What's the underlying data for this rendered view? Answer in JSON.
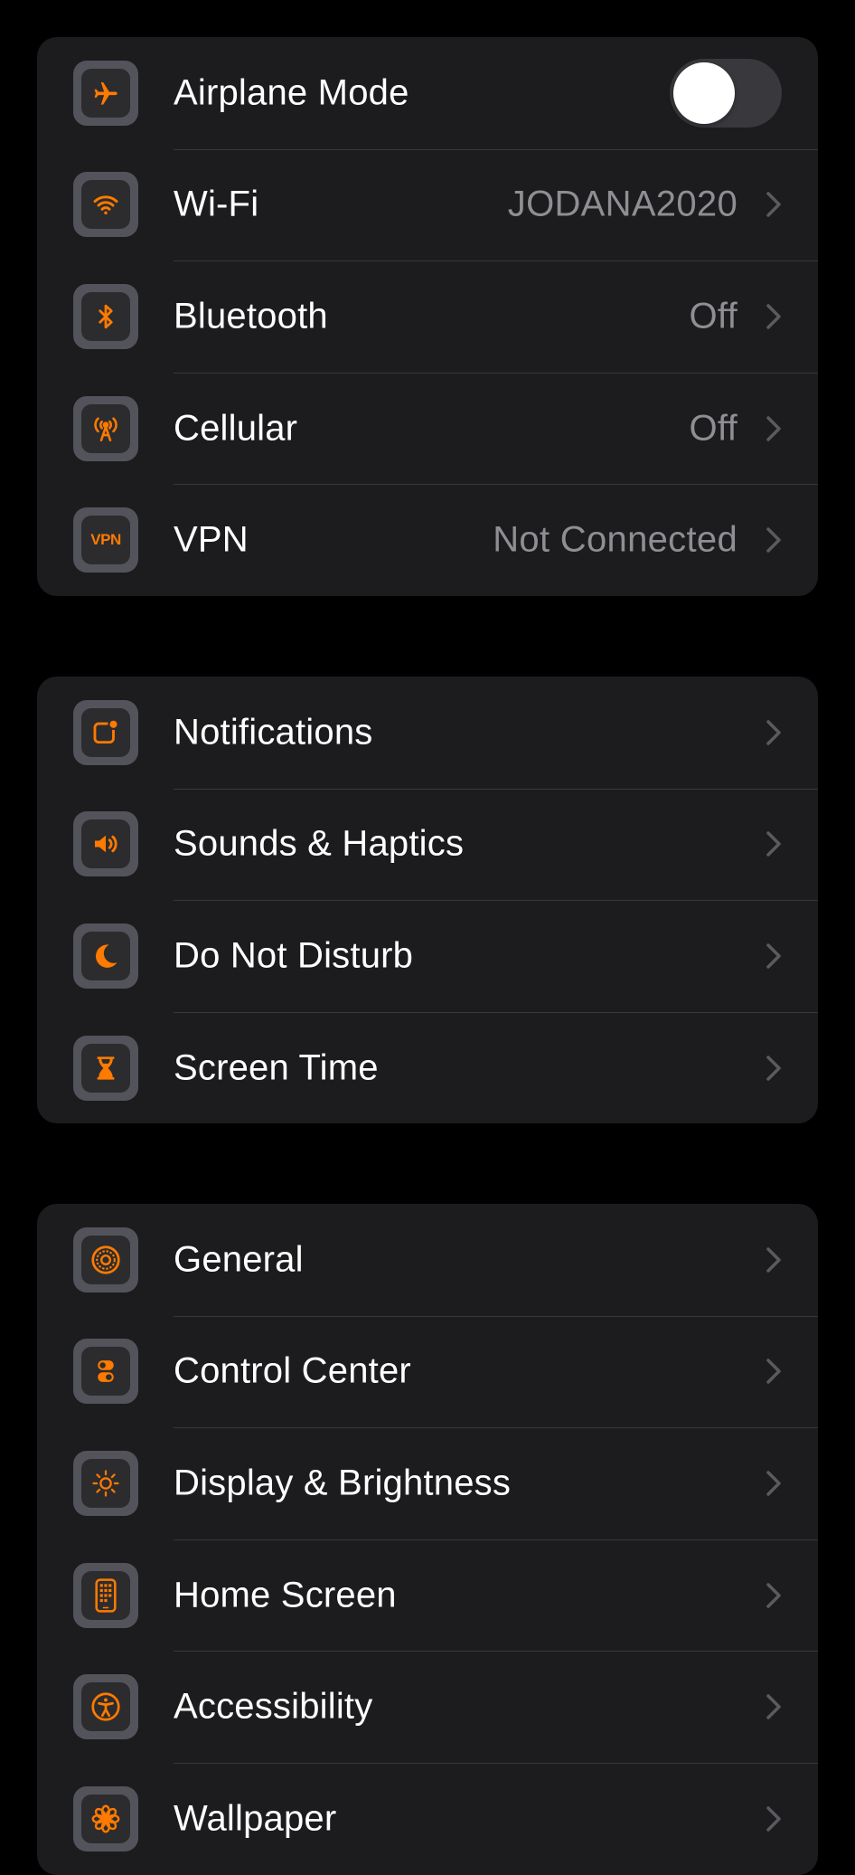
{
  "accent_color": "#ff7a00",
  "groups": [
    {
      "rows": [
        {
          "label": "Airplane Mode",
          "icon": "airplane-icon",
          "control": "toggle",
          "toggle_on": false
        },
        {
          "label": "Wi-Fi",
          "icon": "wifi-icon",
          "value": "JODANA2020"
        },
        {
          "label": "Bluetooth",
          "icon": "bluetooth-icon",
          "value": "Off"
        },
        {
          "label": "Cellular",
          "icon": "cellular-antenna-icon",
          "value": "Off"
        },
        {
          "label": "VPN",
          "icon": "vpn-icon",
          "icon_text": "VPN",
          "value": "Not Connected"
        }
      ]
    },
    {
      "rows": [
        {
          "label": "Notifications",
          "icon": "notifications-icon"
        },
        {
          "label": "Sounds & Haptics",
          "icon": "speaker-icon"
        },
        {
          "label": "Do Not Disturb",
          "icon": "moon-icon"
        },
        {
          "label": "Screen Time",
          "icon": "hourglass-icon"
        }
      ]
    },
    {
      "rows": [
        {
          "label": "General",
          "icon": "gear-icon"
        },
        {
          "label": "Control Center",
          "icon": "toggles-icon"
        },
        {
          "label": "Display & Brightness",
          "icon": "sun-icon"
        },
        {
          "label": "Home Screen",
          "icon": "phone-grid-icon"
        },
        {
          "label": "Accessibility",
          "icon": "accessibility-icon"
        },
        {
          "label": "Wallpaper",
          "icon": "flower-icon"
        }
      ]
    }
  ]
}
